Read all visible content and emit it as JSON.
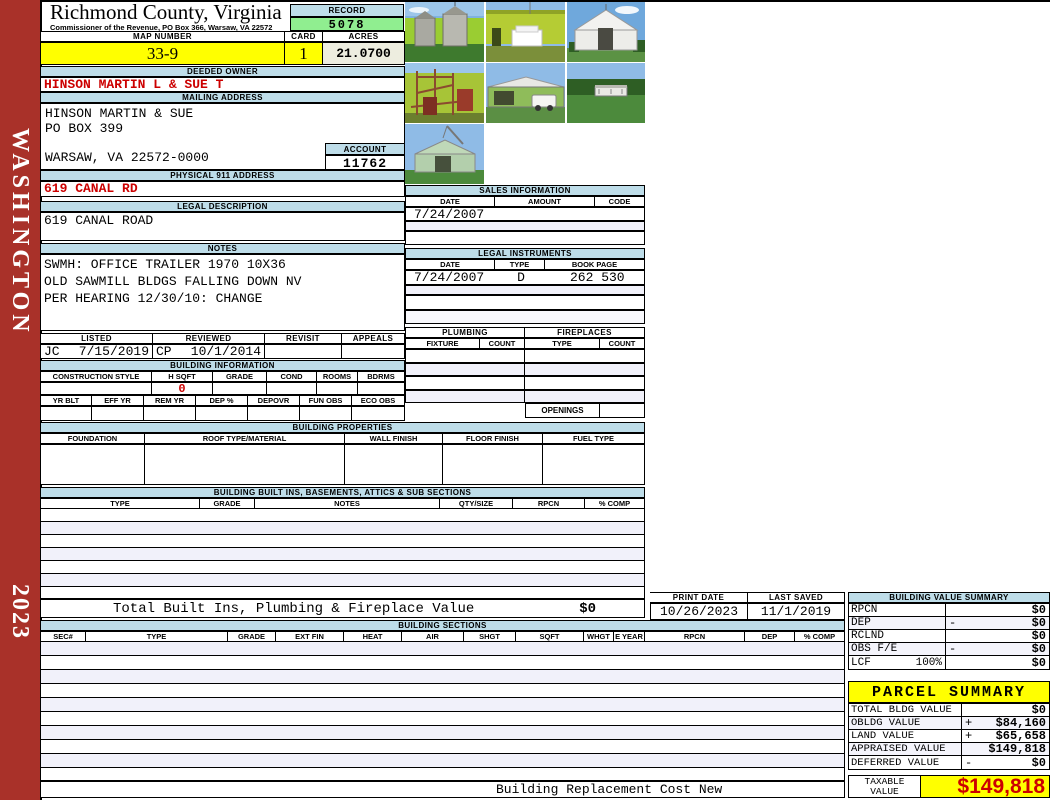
{
  "sidebar": {
    "district": "WASHINGTON",
    "year": "2023"
  },
  "header": {
    "county": "Richmond County, Virginia",
    "subtitle": "Commissioner of the Revenue, PO Box 366, Warsaw, VA 22572",
    "record_label": "RECORD",
    "record": "5078",
    "map_label": "MAP NUMBER",
    "map": "33-9",
    "card_label": "CARD",
    "card": "1",
    "acres_label": "ACRES",
    "acres": "21.0700"
  },
  "owner": {
    "label": "DEEDED OWNER",
    "name": "HINSON MARTIN L & SUE T"
  },
  "mailing": {
    "label": "MAILING ADDRESS",
    "line1": "HINSON MARTIN & SUE",
    "line2": "PO BOX 399",
    "line3": "WARSAW, VA 22572-0000",
    "account_label": "ACCOUNT",
    "account": "11762"
  },
  "physical": {
    "label": "PHYSICAL 911 ADDRESS",
    "value": "619 CANAL RD"
  },
  "legal": {
    "label": "LEGAL DESCRIPTION",
    "value": "619 CANAL ROAD"
  },
  "notes": {
    "label": "NOTES",
    "line1": "SWMH: OFFICE TRAILER 1970 10X36",
    "line2": "OLD SAWMILL BLDGS FALLING DOWN NV",
    "line3": "PER HEARING 12/30/10: CHANGE"
  },
  "review": {
    "headers": [
      "LISTED",
      "REVIEWED",
      "REVISIT",
      "APPEALS"
    ],
    "listed_by": "JC",
    "listed_date": "7/15/2019",
    "reviewed_by": "CP",
    "reviewed_date": "10/1/2014",
    "revisit": "",
    "appeals": ""
  },
  "building_info": {
    "title": "BUILDING INFORMATION",
    "headers1": [
      "CONSTRUCTION STYLE",
      "H SQFT",
      "GRADE",
      "COND",
      "ROOMS",
      "BDRMS"
    ],
    "h_sqft": "0",
    "headers2": [
      "YR BLT",
      "EFF YR",
      "REM YR",
      "DEP %",
      "DEPOVR",
      "FUN OBS",
      "ECO OBS"
    ]
  },
  "building_props": {
    "title": "BUILDING PROPERTIES",
    "headers": [
      "FOUNDATION",
      "ROOF TYPE/MATERIAL",
      "WALL FINISH",
      "FLOOR FINISH",
      "FUEL TYPE"
    ]
  },
  "built_ins": {
    "title": "BUILDING BUILT INS, BASEMENTS, ATTICS & SUB SECTIONS",
    "headers": [
      "TYPE",
      "GRADE",
      "NOTES",
      "QTY/SIZE",
      "RPCN",
      "% COMP"
    ],
    "total_label": "Total Built Ins, Plumbing & Fireplace Value",
    "total_value": "$0"
  },
  "sales": {
    "title": "SALES INFORMATION",
    "headers": [
      "DATE",
      "AMOUNT",
      "CODE"
    ],
    "row1": {
      "date": "7/24/2007",
      "amount": "",
      "code": ""
    }
  },
  "instruments": {
    "title": "LEGAL INSTRUMENTS",
    "headers": [
      "DATE",
      "TYPE",
      "BOOK PAGE"
    ],
    "row1": {
      "date": "7/24/2007",
      "type": "D",
      "book_page": "262 530"
    }
  },
  "plumbing": {
    "title": "PLUMBING",
    "headers": [
      "FIXTURE",
      "COUNT"
    ]
  },
  "fireplaces": {
    "title": "FIREPLACES",
    "headers": [
      "TYPE",
      "COUNT"
    ],
    "openings_label": "OPENINGS"
  },
  "sections": {
    "title": "BUILDING SECTIONS",
    "headers": [
      "SEC#",
      "TYPE",
      "GRADE",
      "EXT FIN",
      "HEAT",
      "AIR",
      "SHGT",
      "SQFT",
      "WHGT",
      "E YEAR",
      "RPCN",
      "DEP",
      "% COMP"
    ]
  },
  "print_info": {
    "print_date_label": "PRINT DATE",
    "print_date": "10/26/2023",
    "last_saved_label": "LAST SAVED",
    "last_saved": "11/1/2019"
  },
  "value_summary": {
    "title": "BUILDING VALUE SUMMARY",
    "rows": [
      {
        "label": "RPCN",
        "pct": "",
        "op": "",
        "value": "$0"
      },
      {
        "label": "DEP",
        "pct": "",
        "op": "-",
        "value": "$0"
      },
      {
        "label": "RCLND",
        "pct": "",
        "op": "",
        "value": "$0"
      },
      {
        "label": "OBS F/E",
        "pct": "",
        "op": "-",
        "value": "$0"
      },
      {
        "label": "LCF",
        "pct": "100%",
        "op": "",
        "value": "$0"
      }
    ]
  },
  "parcel": {
    "title": "PARCEL SUMMARY",
    "rows": [
      {
        "label": "TOTAL BLDG VALUE",
        "op": "",
        "value": "$0"
      },
      {
        "label": "OBLDG VALUE",
        "op": "+",
        "value": "$84,160"
      },
      {
        "label": "LAND VALUE",
        "op": "+",
        "value": "$65,658"
      },
      {
        "label": "APPRAISED VALUE",
        "op": "",
        "value": "$149,818"
      },
      {
        "label": "DEFERRED VALUE",
        "op": "-",
        "value": "$0"
      }
    ],
    "taxable_label1": "TAXABLE",
    "taxable_label2": "VALUE",
    "taxable_value": "$149,818"
  },
  "footer": {
    "replacement_label": "Building Replacement Cost New"
  },
  "colors": {
    "accent_red": "#CC0000",
    "bar_blue": "#BEDDE9",
    "highlight_yellow": "#FFFF00",
    "record_green": "#90EE90",
    "sidebar_maroon": "#A93129"
  }
}
